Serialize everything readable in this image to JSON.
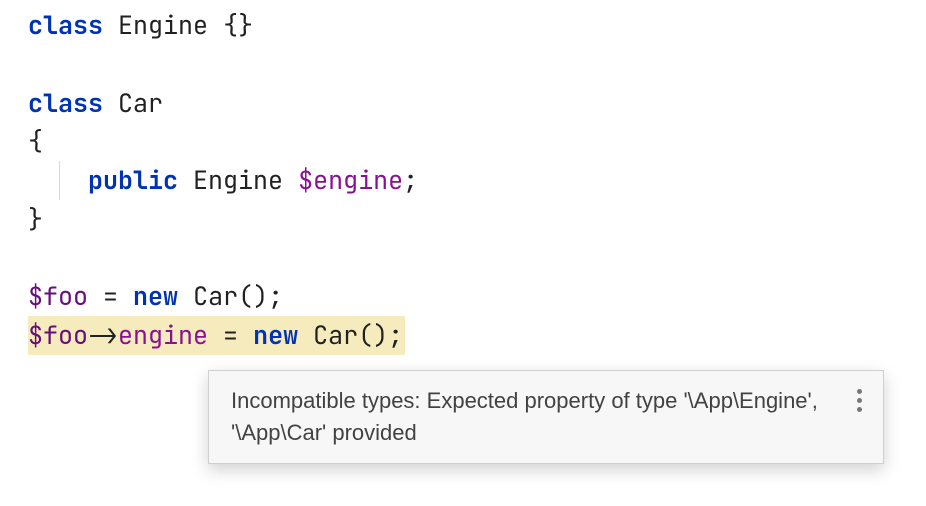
{
  "code": {
    "l1_class": "class",
    "l1_engine": "Engine",
    "l1_braces": "{}",
    "blank": "",
    "l3_class": "class",
    "l3_car": "Car",
    "l4_open": "{",
    "l5_pad": "    ",
    "l5_public": "public",
    "l5_engine": "Engine",
    "l5_var": "$engine",
    "l5_semi": ";",
    "l6_close": "}",
    "l8_foo": "$foo",
    "l8_eq": " = ",
    "l8_new": "new",
    "l8_sp": " ",
    "l8_car": "Car",
    "l8_paren": "();",
    "l9_foo": "$foo",
    "l9_arrow": "->",
    "l9_engine": "engine",
    "l9_eq": " = ",
    "l9_new": "new",
    "l9_sp": " ",
    "l9_car": "Car",
    "l9_paren": "();"
  },
  "tooltip": {
    "message": "Incompatible types: Expected property of type '\\App\\Engine', '\\App\\Car' provided"
  }
}
